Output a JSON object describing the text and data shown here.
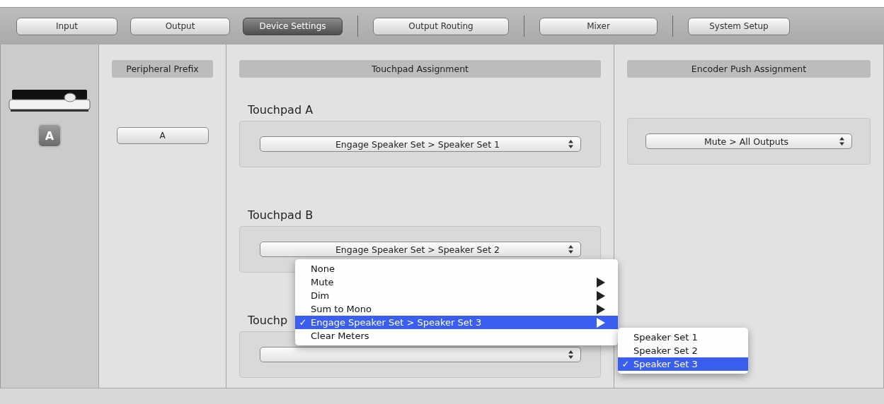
{
  "tab_groups": [
    [
      {
        "label": "Input",
        "selected": false
      },
      {
        "label": "Output",
        "selected": false
      },
      {
        "label": "Device Settings",
        "selected": true
      }
    ],
    [
      {
        "label": "Output Routing",
        "selected": false
      }
    ],
    [
      {
        "label": "Mixer",
        "selected": false
      }
    ],
    [
      {
        "label": "System Setup",
        "selected": false
      }
    ]
  ],
  "device": {
    "badge": "A"
  },
  "peripheral_prefix": {
    "header": "Peripheral Prefix",
    "value": "A"
  },
  "touchpad_assignment": {
    "header": "Touchpad Assignment",
    "touchpads": [
      {
        "label": "Touchpad A",
        "value": "Engage Speaker Set > Speaker Set 1"
      },
      {
        "label": "Touchpad B",
        "value": "Engage Speaker Set > Speaker Set 2"
      },
      {
        "label": "Touchp"
      }
    ]
  },
  "encoder_push_assignment": {
    "header": "Encoder Push Assignment",
    "value": "Mute > All Outputs"
  },
  "menu": {
    "items": [
      {
        "label": "None",
        "kind": "plain",
        "checked": false,
        "selected": false
      },
      {
        "label": "Mute",
        "kind": "submenu",
        "checked": false,
        "selected": false
      },
      {
        "label": "Dim",
        "kind": "submenu",
        "checked": false,
        "selected": false
      },
      {
        "label": "Sum to Mono",
        "kind": "submenu",
        "checked": false,
        "selected": false
      },
      {
        "label": "Engage Speaker Set > Speaker Set 3",
        "kind": "submenu",
        "checked": true,
        "selected": true
      },
      {
        "label": "Clear Meters",
        "kind": "plain",
        "checked": false,
        "selected": false
      }
    ],
    "check_mark": "✓",
    "submenu": [
      {
        "label": "Speaker Set 1",
        "checked": false,
        "selected": false
      },
      {
        "label": "Speaker Set 2",
        "checked": false,
        "selected": false
      },
      {
        "label": "Speaker Set 3",
        "checked": true,
        "selected": true
      }
    ]
  }
}
